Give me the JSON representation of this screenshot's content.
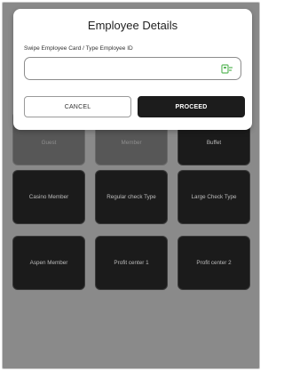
{
  "tiles": [
    {
      "label": "Guest"
    },
    {
      "label": "Member"
    },
    {
      "label": "Buffet"
    },
    {
      "label": "Casino Member"
    },
    {
      "label": "Regular check Type"
    },
    {
      "label": "Large Check Type"
    },
    {
      "label": "Aspen Member"
    },
    {
      "label": "Profit center 1"
    },
    {
      "label": "Profit center 2"
    }
  ],
  "dialog": {
    "title": "Employee Details",
    "field_label": "Swipe Employee Card / Type Employee ID",
    "input_value": "",
    "input_placeholder": "",
    "card_icon": "card-swipe-icon",
    "cancel_label": "CANCEL",
    "proceed_label": "PROCEED"
  },
  "colors": {
    "backdrop": "#8a8a8a",
    "tile_background": "#1b1b1b",
    "primary_button": "#1c1c1c",
    "icon_accent": "#5cb85c"
  }
}
